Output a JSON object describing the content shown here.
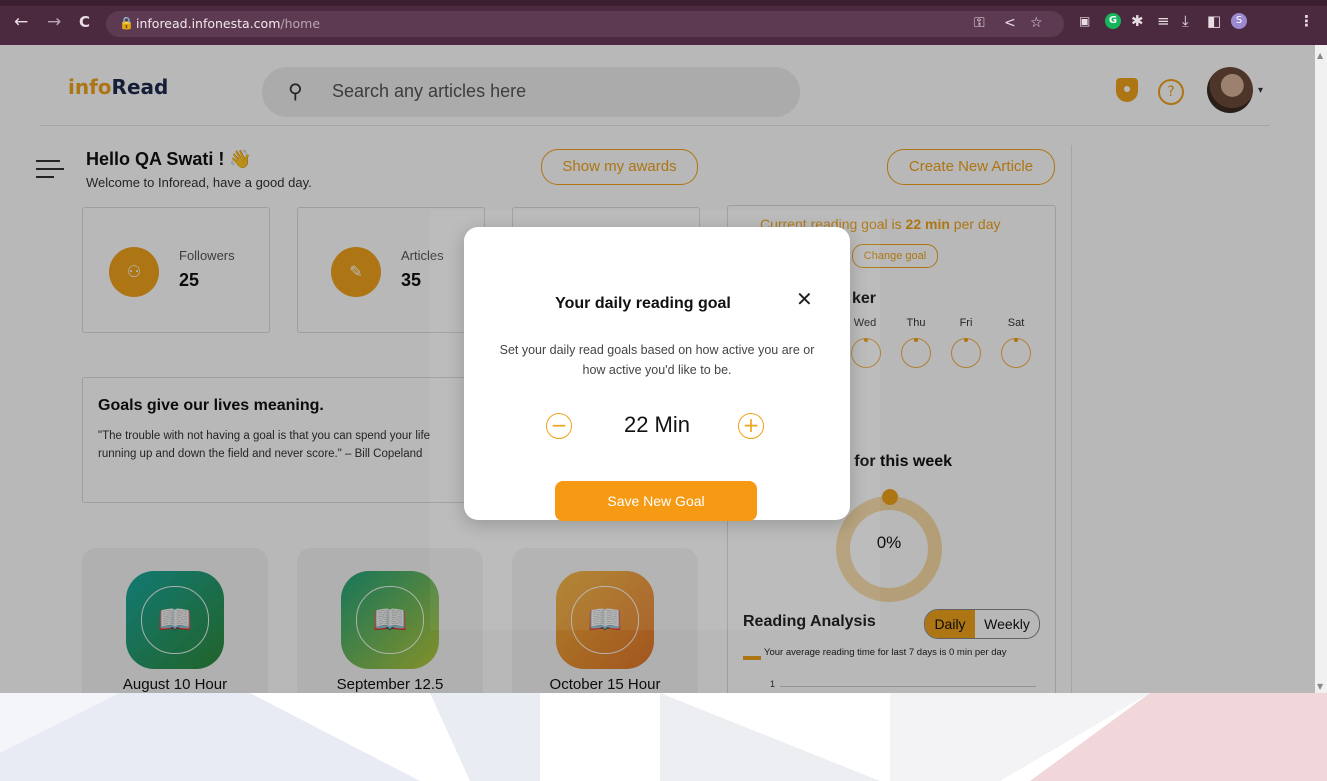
{
  "browser": {
    "url_domain": "inforead.infonesta.com",
    "url_path": "/home",
    "profile_initial": "S",
    "grammarly_initial": "G"
  },
  "header": {
    "logo_part1": "info",
    "logo_part2": "Read",
    "search_placeholder": "Search any articles here",
    "help_label": "?"
  },
  "greeting": {
    "title": "Hello QA Swati ! 👋",
    "subtitle": "Welcome to Inforead, have a good day.",
    "awards_button": "Show my awards",
    "create_button": "Create New Article"
  },
  "stats": [
    {
      "label": "Followers",
      "value": "25"
    },
    {
      "label": "Articles",
      "value": "35"
    }
  ],
  "quote": {
    "title": "Goals give our lives meaning.",
    "text": "\"The trouble with not having a goal is that you can spend your life running up and down the field and never score.\" – Bill Copeland"
  },
  "awards": [
    {
      "label": "August 10 Hour",
      "color_a": "#1aa9a0",
      "color_b": "#2f8a3a"
    },
    {
      "label": "September 12.5",
      "color_a": "#20a47e",
      "color_b": "#b7c93a"
    },
    {
      "label": "October 15 Hour",
      "color_a": "#f2b23a",
      "color_b": "#e2762b"
    }
  ],
  "right_panel": {
    "goal_prefix": "Current reading goal is ",
    "goal_value": "22 min",
    "goal_suffix": " per day",
    "change_goal": "Change goal",
    "tracker_title": "ker",
    "days": [
      "Wed",
      "Thu",
      "Fri",
      "Sat"
    ],
    "progress_title": "ss for this week",
    "progress_value": "0%",
    "analysis_title": "Reading Analysis",
    "toggle_daily": "Daily",
    "toggle_weekly": "Weekly",
    "analysis_text": "Your average reading time for last 7 days is 0 min per day",
    "axis_tick": "1"
  },
  "modal": {
    "title": "Your daily reading goal",
    "description": "Set your daily read goals based on how active you are or how active you'd like to be.",
    "value": "22 Min",
    "minus": "−",
    "plus": "+",
    "save_button": "Save New Goal"
  },
  "colors": {
    "accent": "#f0a31b",
    "browser_frame": "#4b2a3f"
  }
}
